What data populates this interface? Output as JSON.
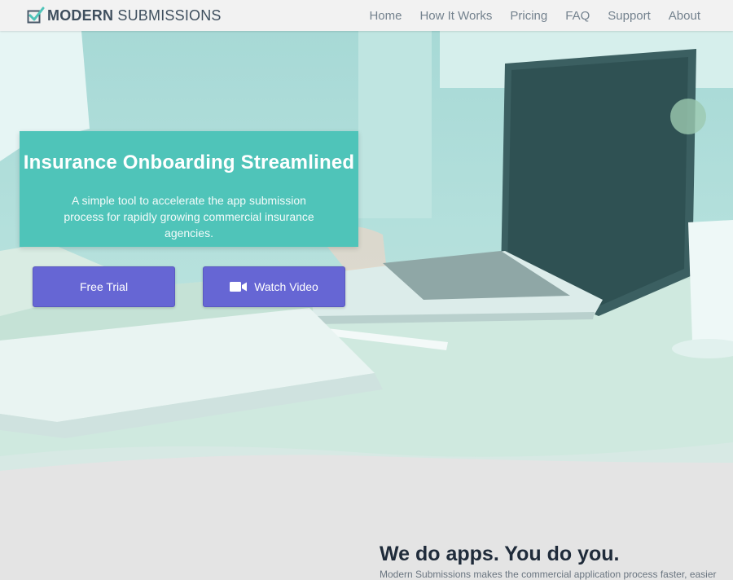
{
  "brand": {
    "name_bold": "MODERN",
    "name_light": " SUBMISSIONS",
    "accent": "#4fc4b9"
  },
  "nav": {
    "items": [
      {
        "label": "Home"
      },
      {
        "label": "How It Works"
      },
      {
        "label": "Pricing"
      },
      {
        "label": "FAQ"
      },
      {
        "label": "Support"
      },
      {
        "label": "About"
      }
    ]
  },
  "hero": {
    "title": "Insurance Onboarding Streamlined",
    "subtitle": "A simple tool to accelerate the app submission process for rapidly growing commercial insurance agencies.",
    "buttons": {
      "trial_label": "Free Trial",
      "video_label": "Watch Video",
      "video_icon": "video-camera-icon",
      "color": "#6666d4"
    }
  },
  "section": {
    "title": "We do apps. You do you.",
    "text_partial": "Modern Submissions makes the commercial application process faster, easier"
  }
}
